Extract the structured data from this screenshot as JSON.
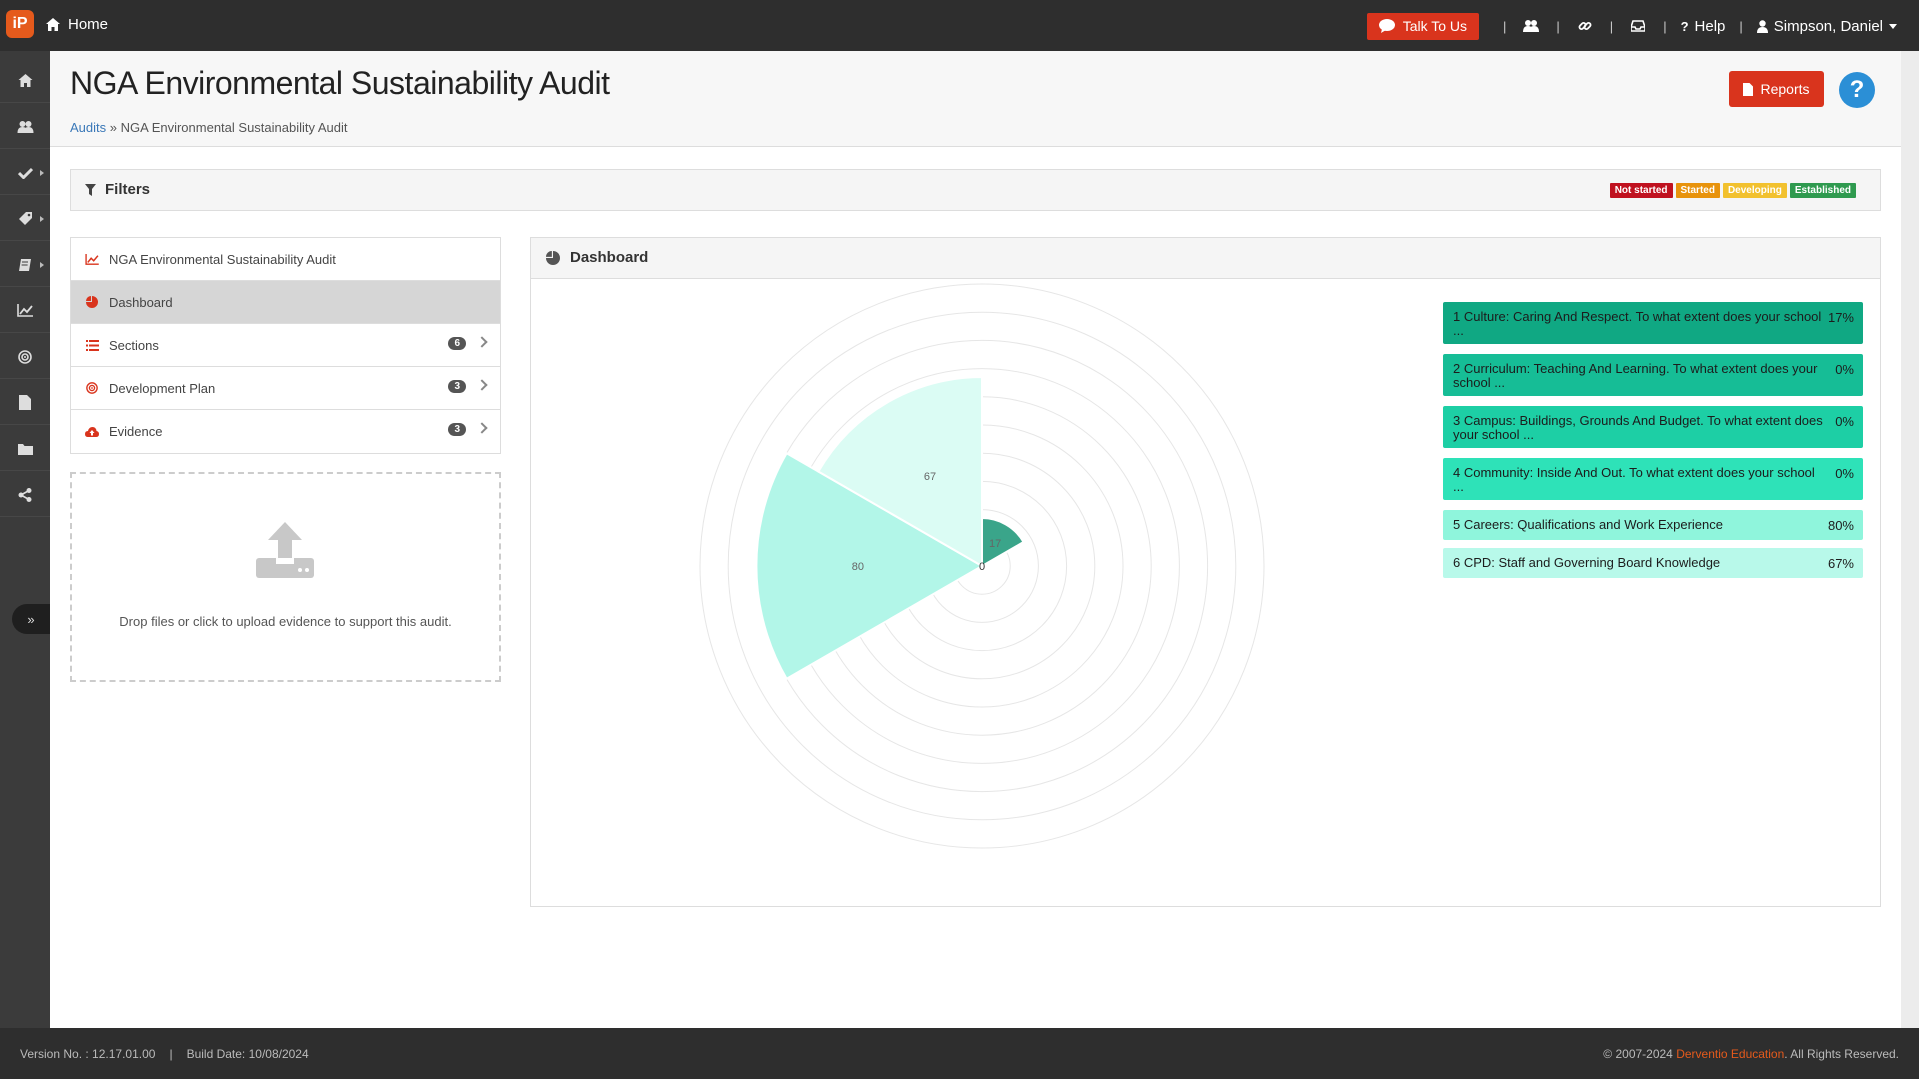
{
  "topbar": {
    "logo_text": "iP",
    "home_label": "Home",
    "talk_label": "Talk To Us",
    "help_label": "Help",
    "user_label": "Simpson, Daniel"
  },
  "header": {
    "title": "NGA Environmental Sustainability Audit",
    "breadcrumb_root": "Audits",
    "breadcrumb_sep": "»",
    "breadcrumb_current": "NGA Environmental Sustainability Audit",
    "reports_label": "Reports",
    "help_symbol": "?"
  },
  "filters": {
    "label": "Filters",
    "legend": [
      {
        "label": "Not started",
        "color": "#c0111f"
      },
      {
        "label": "Started",
        "color": "#e8930c"
      },
      {
        "label": "Developing",
        "color": "#f2c12e"
      },
      {
        "label": "Established",
        "color": "#2f9a4f"
      }
    ]
  },
  "nav": {
    "items": [
      {
        "label": "NGA Environmental Sustainability Audit",
        "icon": "line-chart-icon"
      },
      {
        "label": "Dashboard",
        "icon": "pie-chart-icon"
      },
      {
        "label": "Sections",
        "icon": "list-icon",
        "count": "6"
      },
      {
        "label": "Development Plan",
        "icon": "target-icon",
        "count": "3"
      },
      {
        "label": "Evidence",
        "icon": "cloud-upload-icon",
        "count": "3"
      }
    ]
  },
  "dropzone": {
    "text": "Drop files or click to upload evidence to support this audit."
  },
  "dashboard": {
    "title": "Dashboard"
  },
  "sections": [
    {
      "label": "1 Culture: Caring And Respect. To what extent does your school ...",
      "pct": "17%",
      "color": "#10a883"
    },
    {
      "label": "2 Curriculum: Teaching And Learning. To what extent does your school ...",
      "pct": "0%",
      "color": "#16bd96"
    },
    {
      "label": "3 Campus: Buildings, Grounds And Budget. To what extent does your school ...",
      "pct": "0%",
      "color": "#1dcfa5"
    },
    {
      "label": "4 Community: Inside And Out. To what extent does your school ...",
      "pct": "0%",
      "color": "#2ee2b8"
    },
    {
      "label": "5 Careers: Qualifications and Work Experience",
      "pct": "80%",
      "color": "#8ff5dc"
    },
    {
      "label": "6 CPD: Staff and Governing Board Knowledge",
      "pct": "67%",
      "color": "#b8f9ea"
    }
  ],
  "chart_data": {
    "type": "polar-area",
    "categories": [
      "1 Culture",
      "2 Curriculum",
      "3 Campus",
      "4 Community",
      "5 Careers",
      "6 CPD"
    ],
    "values": [
      17,
      0,
      0,
      0,
      80,
      67
    ],
    "colors": [
      "#3aa58a",
      "#45b898",
      "#52cfa9",
      "#66e3bc",
      "#b2f6e8",
      "#dbfcf4"
    ],
    "rlim": [
      0,
      100
    ],
    "center_label": "0",
    "ring_count": 10
  },
  "footer": {
    "version": "Version No. : 12.17.01.00",
    "build": "Build Date: 10/08/2024",
    "separator": "|",
    "copyright_prefix": "© 2007-2024",
    "brand": "Derventio Education",
    "copyright_suffix": ". All Rights Reserved."
  }
}
